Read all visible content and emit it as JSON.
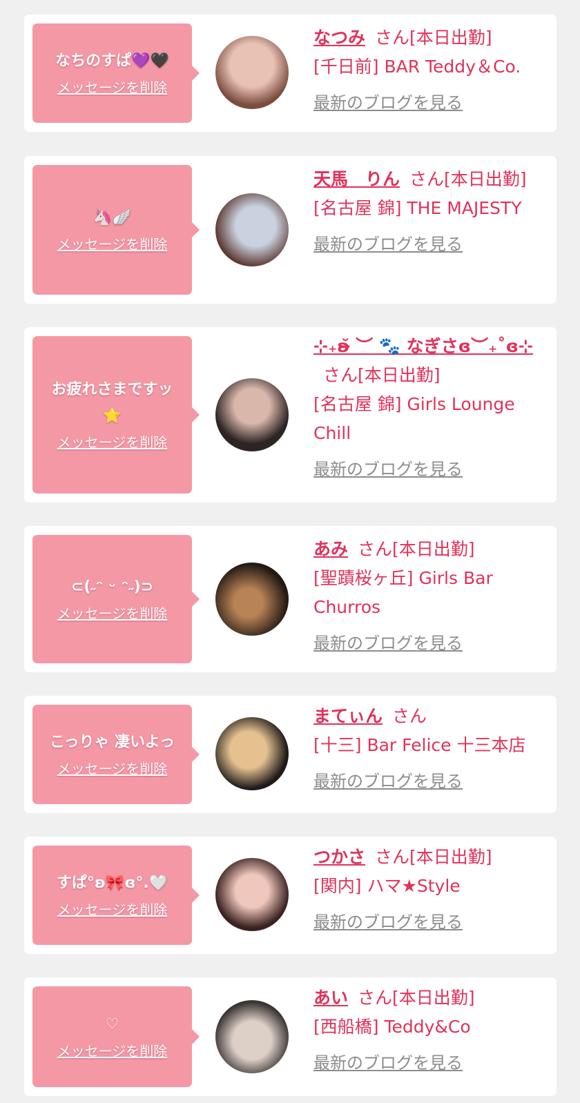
{
  "delete_label": "メッセージを削除",
  "blog_label": "最新のブログを見る",
  "items": [
    {
      "message": "なちのすぱ💜🖤",
      "name": "なつみ",
      "suffix": "さん[本日出勤]",
      "shop": "[千日前] BAR Teddy＆Co.",
      "avatar_colors": [
        "#e9c2b6",
        "#7a4d3f"
      ]
    },
    {
      "message": "🦄🪽",
      "name": "天馬　りん",
      "suffix": "さん[本日出勤]",
      "shop": "[名古屋 錦] THE MAJESTY",
      "avatar_colors": [
        "#c9d2de",
        "#5b3530"
      ]
    },
    {
      "message": "お疲れさまですッ\n⭐",
      "name": "⊹₊ʚ̴̆ ︶ 🐾 なぎさɞ︶₊˚ɞ⊹",
      "suffix": "さん[本日出勤]",
      "shop": "[名古屋 錦] Girls Lounge Chill",
      "avatar_colors": [
        "#d9b7ab",
        "#2d2424"
      ]
    },
    {
      "message": "⊂(˶ᵔ ᵕ ᵔ˶)⊃",
      "name": "あみ",
      "suffix": "さん[本日出勤]",
      "shop": "[聖蹟桜ヶ丘] Girls Bar Churros",
      "avatar_colors": [
        "#b88355",
        "#231a14"
      ]
    },
    {
      "message": "こっりゃ 凄いよっ",
      "name": "まてぃん",
      "suffix": "さん",
      "shop": "[十三] Bar Felice 十三本店",
      "avatar_colors": [
        "#e4c18f",
        "#1e1a1a"
      ]
    },
    {
      "message": "すぱ°ʚ🎀ɞ°.🤍",
      "name": "つかさ",
      "suffix": "さん[本日出勤]",
      "shop": "[関内] ハマ★Style",
      "avatar_colors": [
        "#f0c7bd",
        "#3a2220"
      ]
    },
    {
      "message": "♡",
      "name": "あい",
      "suffix": "さん[本日出勤]",
      "shop": "[西船橋] Teddy&Co",
      "avatar_colors": [
        "#ddd0c7",
        "#3b3535"
      ]
    }
  ]
}
